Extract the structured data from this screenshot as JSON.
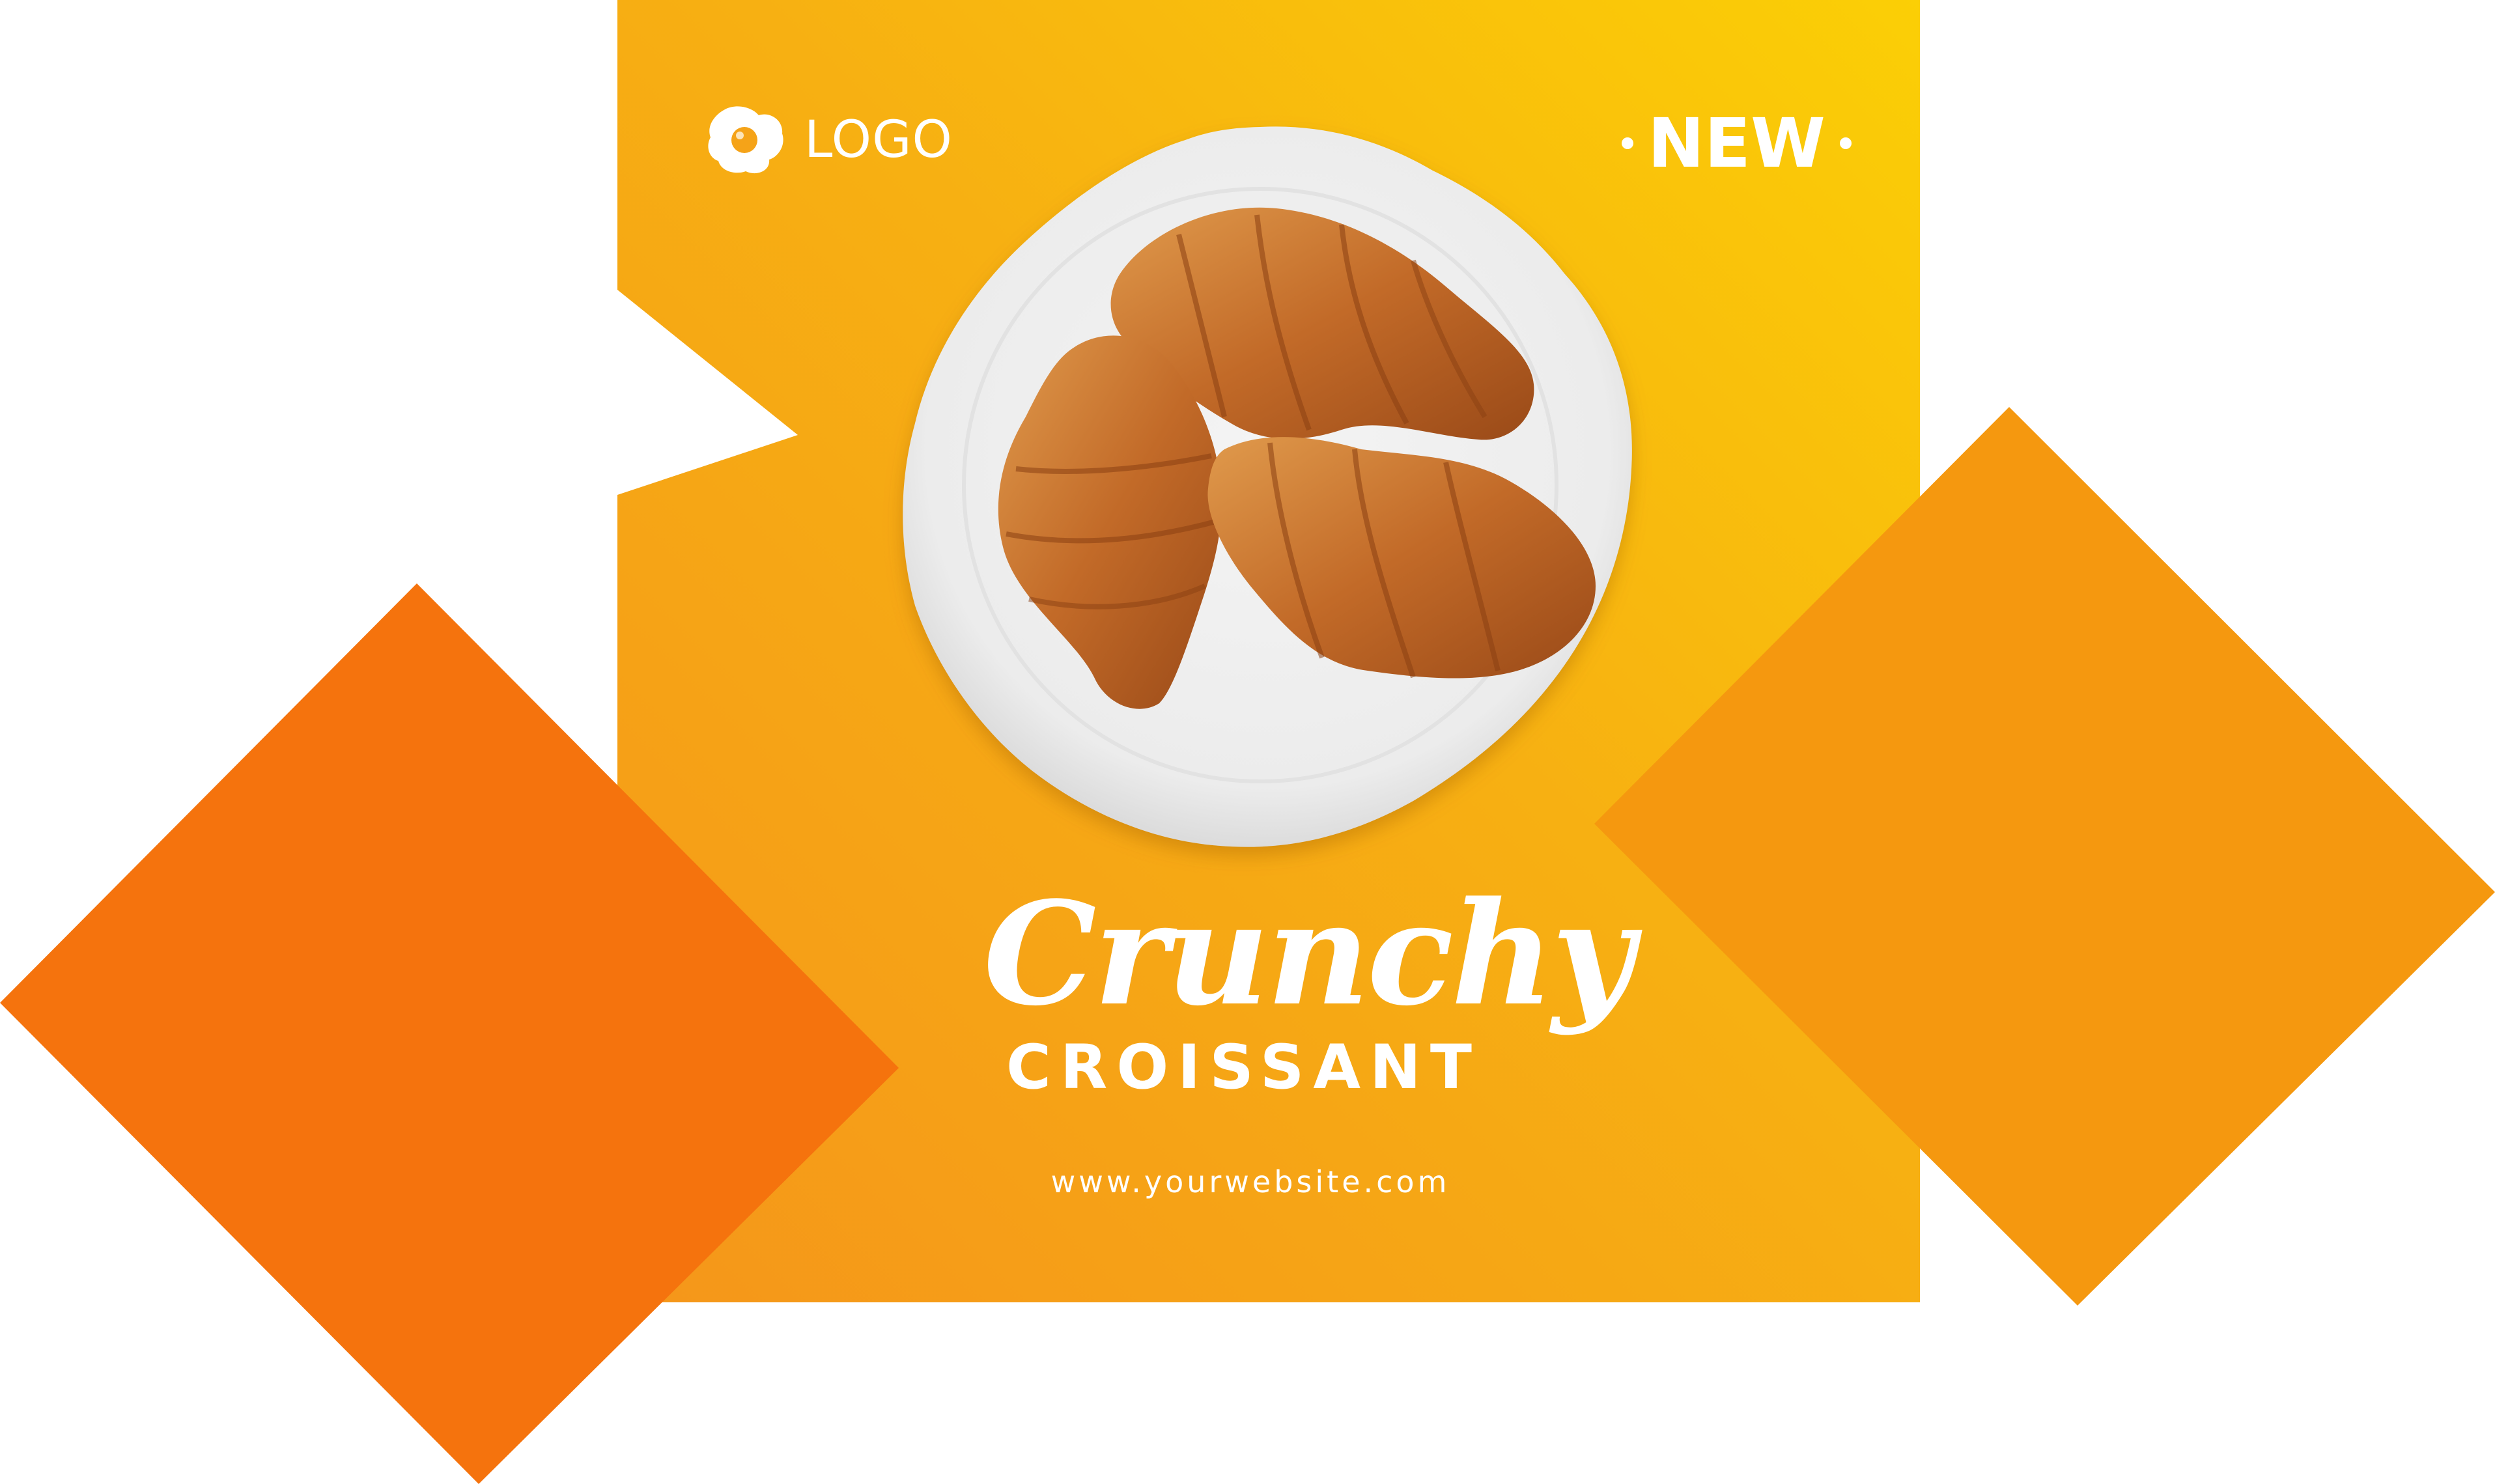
{
  "brand": {
    "logo_text": "LOGO",
    "logo_icon": "fried-egg-icon"
  },
  "badge": {
    "text": "NEW"
  },
  "headline": {
    "script": "Crunchy",
    "sub": "CROISSANT"
  },
  "footer": {
    "website": "www.yourwebsite.com"
  },
  "image": {
    "subject": "three croissants on a white plate"
  },
  "colors": {
    "panel_start": "#F59A12",
    "panel_end": "#FACC08",
    "diamond_left": "#F5730D",
    "diamond_right": "#F5980F",
    "plate": "#F0F0F0",
    "croissant": "#C8742E",
    "text": "#FFFFFF"
  }
}
